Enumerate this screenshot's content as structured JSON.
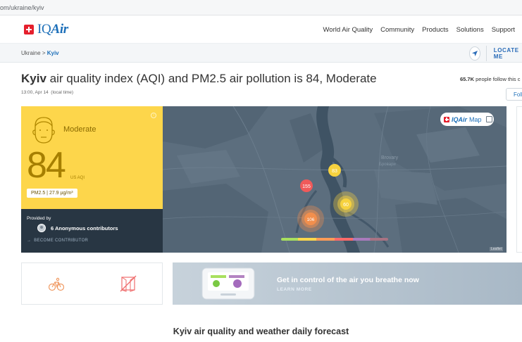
{
  "browser": {
    "url": "om/ukraine/kyiv"
  },
  "header": {
    "brand_prefix": "IQ",
    "brand_suffix": "Air",
    "nav": [
      "World Air Quality",
      "Community",
      "Products",
      "Solutions",
      "Support"
    ]
  },
  "breadcrumb": {
    "parent": "Ukraine",
    "separator": ">",
    "current": "Kyiv",
    "locate_label": "LOCATE ME"
  },
  "title": {
    "city": "Kyiv",
    "rest": " air quality index (AQI) and PM2.5 air pollution is 84, Moderate",
    "time": "13:00, Apr 14",
    "time_note": "(local time)",
    "followers_count": "65.7K",
    "followers_text": " people follow this c",
    "follow_button": "Foll"
  },
  "aqi": {
    "level": "Moderate",
    "value": "84",
    "unit": "US AQI",
    "pollutant": "PM2.5 | 27.9 µg/m³",
    "info": "i",
    "color": "#fdd64b"
  },
  "contributors": {
    "provided_by": "Provided by",
    "count_label": "6 Anonymous contributors",
    "become": "BECOME CONTRIBUTOR"
  },
  "map": {
    "badge_brand": "IQAir",
    "badge_label": "Map",
    "attribution": "Leaflet",
    "place_label": "Brovary",
    "place_label_local": "Бровари",
    "stations": [
      {
        "value": "155",
        "color": "#ef5a5a"
      },
      {
        "value": "83",
        "color": "#f6d23f"
      },
      {
        "value": "60",
        "color": "#f6d23f"
      },
      {
        "value": "106",
        "color": "#f28f4d"
      }
    ],
    "scale_colors": [
      "#a8e05f",
      "#fdd74b",
      "#fe9b57",
      "#fe6a69",
      "#a97abc",
      "#a87383"
    ]
  },
  "promo": {
    "headline": "Get in control of the air you breathe now",
    "cta": "LEARN MORE"
  },
  "forecast_heading": "Kyiv air quality and weather daily forecast"
}
